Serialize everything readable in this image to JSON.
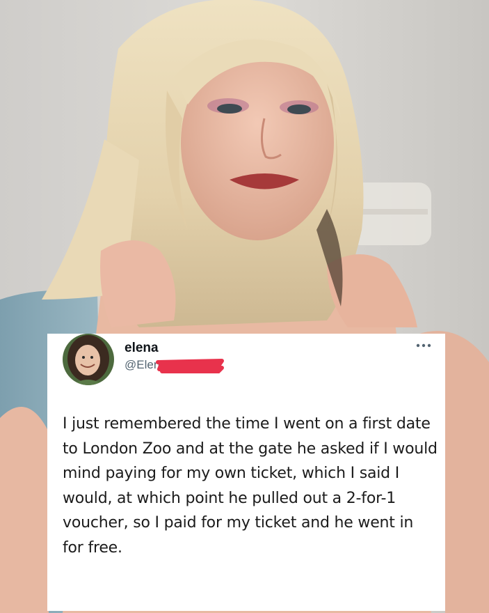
{
  "tweet": {
    "display_name": "elena",
    "handle": "@Elena",
    "text": "I just remembered the time I went on a first date to London Zoo and at the gate he asked if I would mind paying for my own ticket, which I said I would, at which point he pulled out a 2-for-1 voucher, so I paid for my ticket and he went in for free.",
    "more_icon": "more-horizontal-icon",
    "avatar_icon": "profile-avatar"
  },
  "colors": {
    "redaction": "#e8324c",
    "name": "#0f1419",
    "handle": "#536471",
    "card_background": "#ffffff"
  }
}
